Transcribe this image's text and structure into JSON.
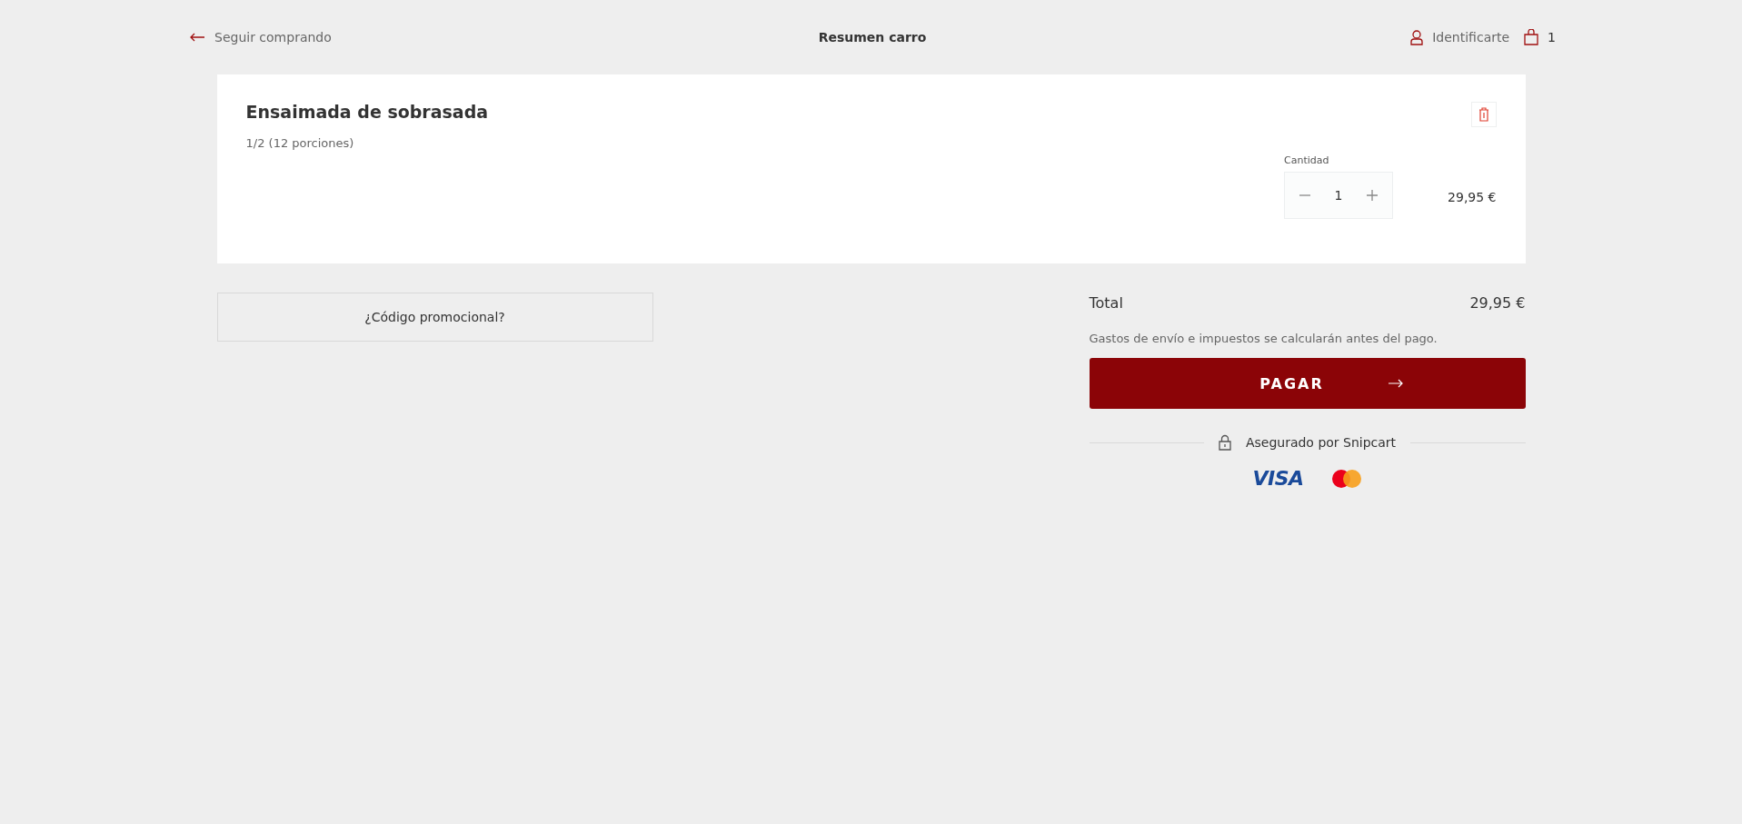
{
  "header": {
    "back_link": "Seguir comprando",
    "title": "Resumen carro",
    "login": "Identificarte",
    "cart_count": "1"
  },
  "items": [
    {
      "name": "Ensaimada de sobrasada",
      "variant": "1/2 (12 porciones)",
      "quantity_label": "Cantidad",
      "quantity": "1",
      "price": "29,95 €"
    }
  ],
  "promo": {
    "label": "¿Código promocional?"
  },
  "summary": {
    "total_label": "Total",
    "total_value": "29,95 €",
    "note": "Gastos de envío e impuestos se calcularán antes del pago.",
    "pay_button": "PAGAR",
    "secured": "Asegurado por Snipcart",
    "payment_logos": [
      {
        "kind": "visa",
        "text": "VISA"
      },
      {
        "kind": "mastercard"
      }
    ]
  }
}
